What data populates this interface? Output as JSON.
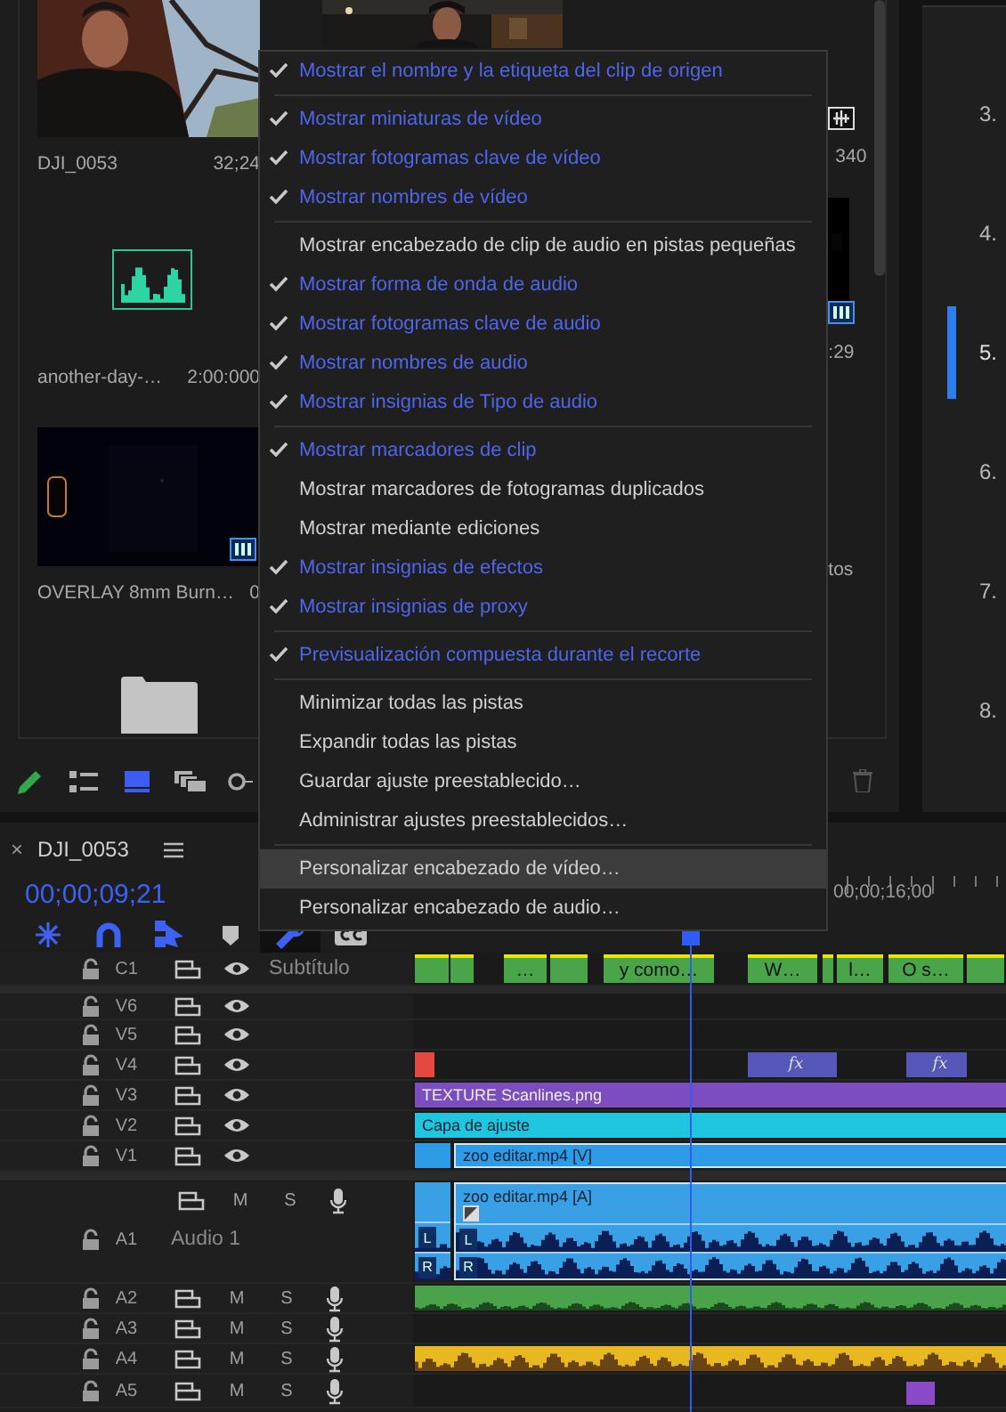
{
  "project_panel": {
    "bin_items": [
      {
        "name": "DJI_0053",
        "duration": "32;24",
        "kind": "picture"
      },
      {
        "name": "another-day-…",
        "duration": "2:00:000",
        "kind": "audio"
      },
      {
        "name": "OVERLAY 8mm Burn…",
        "duration": "0",
        "kind": "picture"
      }
    ],
    "column_3_texts": [
      "340",
      ":29",
      "tos"
    ],
    "view_buttons": [
      {
        "kind": "list",
        "selected": false
      },
      {
        "kind": "icon",
        "selected": true
      },
      {
        "kind": "freeform",
        "selected": false
      }
    ]
  },
  "side_list": [
    {
      "label": "3.",
      "selected": false
    },
    {
      "label": "4.",
      "selected": false
    },
    {
      "label": "5.",
      "selected": true
    },
    {
      "label": "6.",
      "selected": false
    },
    {
      "label": "7.",
      "selected": false
    },
    {
      "label": "8.",
      "selected": false
    }
  ],
  "context_menu": {
    "groups": [
      {
        "items": [
          {
            "label": "Mostrar el nombre y la etiqueta del clip de origen",
            "checked": true,
            "highlighted": false
          }
        ]
      },
      {
        "items": [
          {
            "label": "Mostrar miniaturas de vídeo",
            "checked": true,
            "highlighted": false
          },
          {
            "label": "Mostrar fotogramas clave de vídeo",
            "checked": true,
            "highlighted": false
          },
          {
            "label": "Mostrar nombres de vídeo",
            "checked": true,
            "highlighted": false
          }
        ]
      },
      {
        "items": [
          {
            "label": "Mostrar encabezado de clip de audio en pistas pequeñas",
            "checked": false,
            "highlighted": false
          },
          {
            "label": "Mostrar forma de onda de audio",
            "checked": true,
            "highlighted": false
          },
          {
            "label": "Mostrar fotogramas clave de audio",
            "checked": true,
            "highlighted": false
          },
          {
            "label": "Mostrar nombres de audio",
            "checked": true,
            "highlighted": false
          },
          {
            "label": "Mostrar insignias de Tipo de audio",
            "checked": true,
            "highlighted": false
          }
        ]
      },
      {
        "items": [
          {
            "label": "Mostrar marcadores de clip",
            "checked": true,
            "highlighted": false
          },
          {
            "label": "Mostrar marcadores de fotogramas duplicados",
            "checked": false,
            "highlighted": false
          },
          {
            "label": "Mostrar mediante ediciones",
            "checked": false,
            "highlighted": false
          },
          {
            "label": "Mostrar insignias de efectos",
            "checked": true,
            "highlighted": false
          },
          {
            "label": "Mostrar insignias de proxy",
            "checked": true,
            "highlighted": false
          }
        ]
      },
      {
        "items": [
          {
            "label": "Previsualización compuesta durante el recorte",
            "checked": true,
            "highlighted": false
          }
        ]
      },
      {
        "items": [
          {
            "label": "Minimizar todas las pistas",
            "checked": false,
            "highlighted": false
          },
          {
            "label": "Expandir todas las pistas",
            "checked": false,
            "highlighted": false
          },
          {
            "label": "Guardar ajuste preestablecido…",
            "checked": false,
            "highlighted": false
          },
          {
            "label": "Administrar ajustes preestablecidos…",
            "checked": false,
            "highlighted": false
          }
        ]
      },
      {
        "items": [
          {
            "label": "Personalizar encabezado de vídeo…",
            "checked": false,
            "highlighted": true
          },
          {
            "label": "Personalizar encabezado de audio…",
            "checked": false,
            "highlighted": false
          }
        ]
      }
    ]
  },
  "timeline": {
    "tab": {
      "close": "×",
      "title": "DJI_0053"
    },
    "timecode": "00;00;09;21",
    "ruler_label": "00;00;16;00",
    "tools": [
      {
        "kind": "nest",
        "selected": false
      },
      {
        "kind": "snap",
        "selected": false
      },
      {
        "kind": "linked",
        "selected": false
      },
      {
        "kind": "marker",
        "selected": false
      },
      {
        "kind": "settings",
        "selected": true
      },
      {
        "kind": "captions",
        "selected": false
      }
    ],
    "caption_clips": [
      "…",
      "y como…",
      "W…",
      "l…",
      "O s…"
    ],
    "tracks": [
      {
        "name": "C1",
        "kind": "caption",
        "label": "Subtítulo"
      },
      {
        "name": "V6",
        "kind": "video"
      },
      {
        "name": "V5",
        "kind": "video"
      },
      {
        "name": "V4",
        "kind": "video",
        "clips": [
          {
            "label": "fx"
          },
          {
            "label": "fx"
          }
        ]
      },
      {
        "name": "V3",
        "kind": "video",
        "clips": [
          {
            "label": "TEXTURE Scanlines.png"
          }
        ]
      },
      {
        "name": "V2",
        "kind": "video",
        "clips": [
          {
            "label": "Capa de ajuste"
          }
        ]
      },
      {
        "name": "V1",
        "kind": "video",
        "clips": [
          {
            "label": "zoo editar.mp4 [V]"
          }
        ]
      },
      {
        "name": "A1",
        "kind": "audio",
        "label": "Audio 1",
        "mute": "M",
        "solo": "S",
        "clips": [
          {
            "channels": [
              "L",
              "R"
            ]
          },
          {
            "label": "zoo editar.mp4 [A]",
            "channels": [
              "L",
              "R"
            ]
          }
        ]
      },
      {
        "name": "A2",
        "kind": "audio",
        "mute": "M",
        "solo": "S"
      },
      {
        "name": "A3",
        "kind": "audio",
        "mute": "M",
        "solo": "S"
      },
      {
        "name": "A4",
        "kind": "audio",
        "mute": "M",
        "solo": "S"
      },
      {
        "name": "A5",
        "kind": "audio",
        "mute": "M",
        "solo": "S"
      }
    ]
  }
}
